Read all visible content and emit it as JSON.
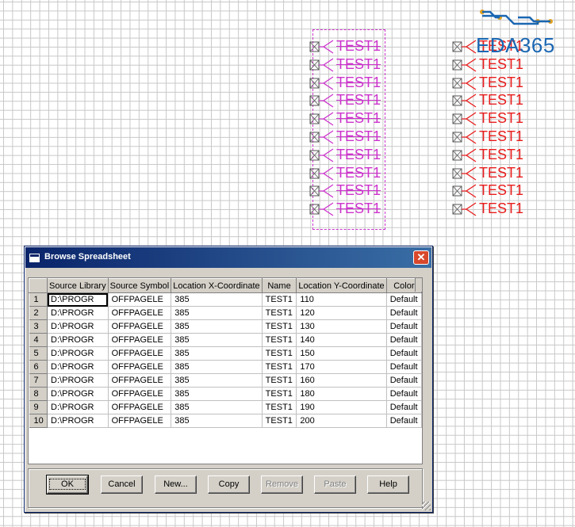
{
  "schematic": {
    "selected_labels": [
      "TEST1",
      "TEST1",
      "TEST1",
      "TEST1",
      "TEST1",
      "TEST1",
      "TEST1",
      "TEST1",
      "TEST1",
      "TEST1"
    ],
    "unselected_labels": [
      "TEST1",
      "TEST1",
      "TEST1",
      "TEST1",
      "TEST1",
      "TEST1",
      "TEST1",
      "TEST1",
      "TEST1",
      "TEST1"
    ],
    "selected_color": "#cc33cc",
    "unselected_color": "#e81c1c"
  },
  "logo": {
    "text": "EDA365",
    "color": "#1b67b2",
    "accent": "#e0a020"
  },
  "dialog": {
    "title": "Browse Spreadsheet",
    "close_glyph": "✕",
    "columns": [
      "Source Library",
      "Source Symbol",
      "Location X-Coordinate",
      "Name",
      "Location Y-Coordinate",
      "Color"
    ],
    "rows": [
      {
        "n": "1",
        "lib": "D:\\PROGR",
        "sym": "OFFPAGELE",
        "x": "385",
        "name": "TEST1",
        "y": "110",
        "color": "Default"
      },
      {
        "n": "2",
        "lib": "D:\\PROGR",
        "sym": "OFFPAGELE",
        "x": "385",
        "name": "TEST1",
        "y": "120",
        "color": "Default"
      },
      {
        "n": "3",
        "lib": "D:\\PROGR",
        "sym": "OFFPAGELE",
        "x": "385",
        "name": "TEST1",
        "y": "130",
        "color": "Default"
      },
      {
        "n": "4",
        "lib": "D:\\PROGR",
        "sym": "OFFPAGELE",
        "x": "385",
        "name": "TEST1",
        "y": "140",
        "color": "Default"
      },
      {
        "n": "5",
        "lib": "D:\\PROGR",
        "sym": "OFFPAGELE",
        "x": "385",
        "name": "TEST1",
        "y": "150",
        "color": "Default"
      },
      {
        "n": "6",
        "lib": "D:\\PROGR",
        "sym": "OFFPAGELE",
        "x": "385",
        "name": "TEST1",
        "y": "170",
        "color": "Default"
      },
      {
        "n": "7",
        "lib": "D:\\PROGR",
        "sym": "OFFPAGELE",
        "x": "385",
        "name": "TEST1",
        "y": "160",
        "color": "Default"
      },
      {
        "n": "8",
        "lib": "D:\\PROGR",
        "sym": "OFFPAGELE",
        "x": "385",
        "name": "TEST1",
        "y": "180",
        "color": "Default"
      },
      {
        "n": "9",
        "lib": "D:\\PROGR",
        "sym": "OFFPAGELE",
        "x": "385",
        "name": "TEST1",
        "y": "190",
        "color": "Default"
      },
      {
        "n": "10",
        "lib": "D:\\PROGR",
        "sym": "OFFPAGELE",
        "x": "385",
        "name": "TEST1",
        "y": "200",
        "color": "Default"
      }
    ],
    "buttons": {
      "ok": "OK",
      "cancel": "Cancel",
      "new": "New...",
      "copy": "Copy",
      "remove": "Remove",
      "paste": "Paste",
      "help": "Help"
    }
  }
}
